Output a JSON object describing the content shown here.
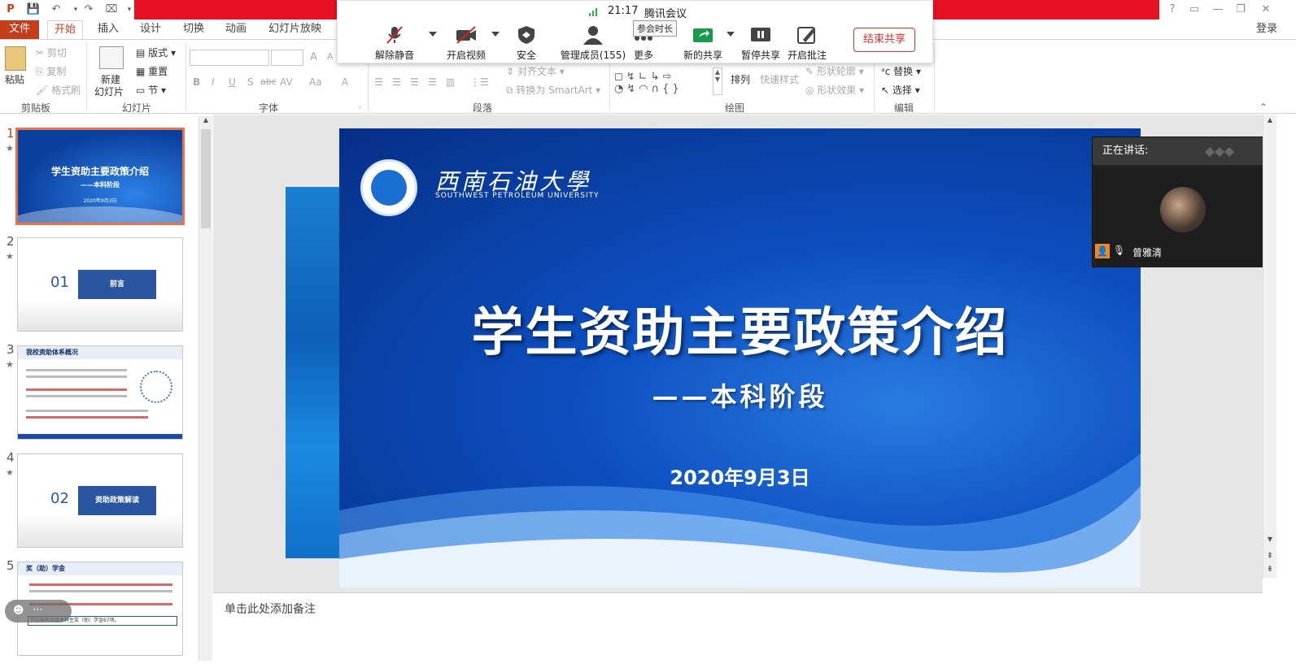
{
  "titlebar": {
    "app_icon": "powerpoint-icon",
    "window_controls": [
      "?",
      "□",
      "—",
      "❐",
      "✕"
    ]
  },
  "tabs": [
    "文件",
    "开始",
    "插入",
    "设计",
    "切换",
    "动画",
    "幻灯片放映"
  ],
  "login_label": "登录",
  "ribbon": {
    "clipboard": {
      "paste": "粘贴",
      "cut": "剪切",
      "copy": "复制",
      "format": "格式刷",
      "label": "剪贴板"
    },
    "slides": {
      "new": "新建",
      "new2": "幻灯片",
      "layout": "版式",
      "reset": "重置",
      "section": "节",
      "label": "幻灯片"
    },
    "font": {
      "label": "字体",
      "b": "B",
      "i": "I",
      "u": "U",
      "s": "S",
      "abc": "abc",
      "av": "AV",
      "aa": "Aa",
      "a": "A"
    },
    "paragraph": {
      "label": "段落",
      "align_text": "对齐文本",
      "smartart": "转换为 SmartArt"
    },
    "drawing": {
      "label": "绘图",
      "arrange": "排列",
      "quick_styles": "快速样式",
      "outline": "形状轮廓",
      "effects": "形状效果"
    },
    "editing": {
      "label": "编辑",
      "replace": "替换",
      "select": "选择"
    }
  },
  "meeting": {
    "time": "21:17",
    "app": "腾讯会议",
    "tooltip": "参会时长",
    "buttons": [
      {
        "label": "解除静音",
        "icon": "mic-muted-icon"
      },
      {
        "label": "开启视频",
        "icon": "camera-off-icon"
      },
      {
        "label": "安全",
        "icon": "shield-icon"
      },
      {
        "label": "管理成员(155)",
        "icon": "members-icon"
      },
      {
        "label": "更多",
        "icon": "more-icon"
      },
      {
        "label": "新的共享",
        "icon": "share-icon"
      },
      {
        "label": "暂停共享",
        "icon": "pause-icon"
      },
      {
        "label": "开启批注",
        "icon": "annotate-icon"
      }
    ],
    "end_share": "结束共享"
  },
  "thumbnails": [
    {
      "num": "1",
      "title": "学生资助主要政策介绍",
      "sub": "——本科阶段",
      "date": "2020年9月3日"
    },
    {
      "num": "2",
      "sec_num": "01",
      "title": "前言"
    },
    {
      "num": "3",
      "title": "我校资助体系概况"
    },
    {
      "num": "4",
      "sec_num": "02",
      "title": "资助政策解读"
    },
    {
      "num": "5",
      "title": "奖（助）学金",
      "note": "学校现有各级本科生奖（助）学金67项。"
    }
  ],
  "slide": {
    "uni_cn": "西南石油大學",
    "uni_en": "SOUTHWEST PETROLEUM UNIVERSITY",
    "title": "学生资助主要政策介绍",
    "subtitle": "——本科阶段",
    "date": "2020年9月3日"
  },
  "notes_placeholder": "单击此处添加备注",
  "speaker": {
    "header": "正在讲话:",
    "name": "曾雅清"
  }
}
